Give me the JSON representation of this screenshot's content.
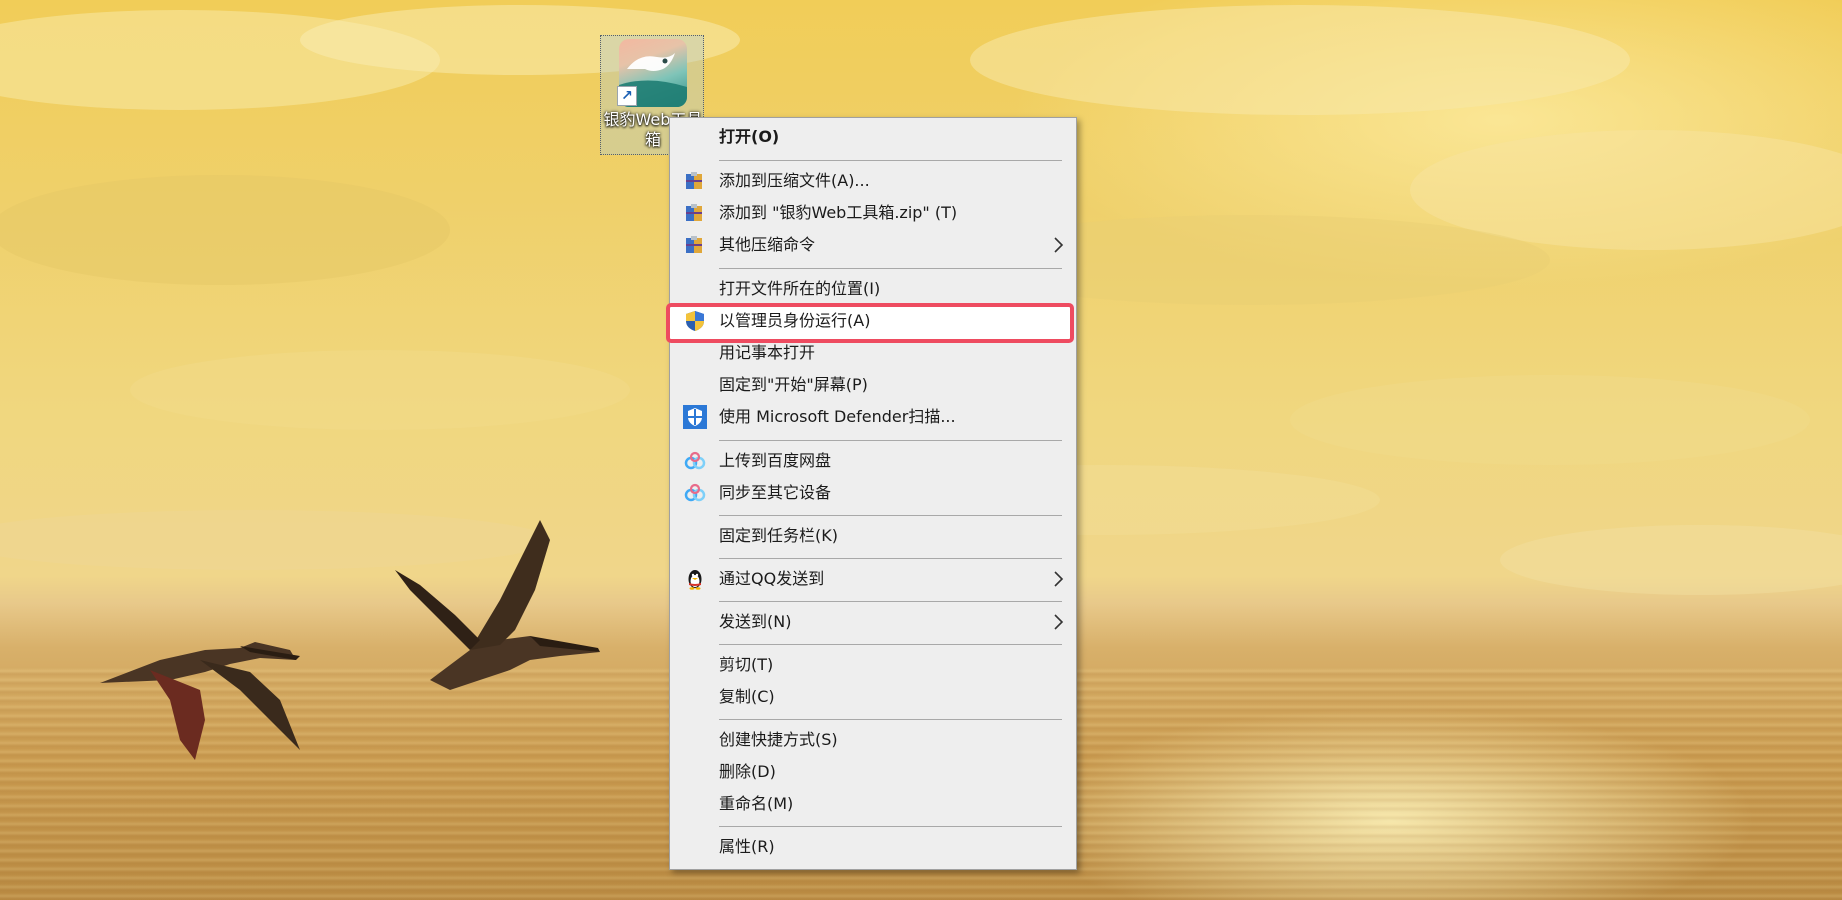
{
  "desktop": {
    "shortcut": {
      "label": "银豹Web工具箱",
      "icon": "app-shortcut-icon"
    }
  },
  "context_menu": {
    "items": [
      {
        "label": "打开(O)",
        "bold": true,
        "icon": null
      },
      {
        "label": "添加到压缩文件(A)...",
        "icon": "archive-icon"
      },
      {
        "label": "添加到 \"银豹Web工具箱.zip\" (T)",
        "icon": "archive-icon"
      },
      {
        "label": "其他压缩命令",
        "icon": "archive-icon",
        "submenu": true
      },
      {
        "label": "打开文件所在的位置(I)",
        "icon": null
      },
      {
        "label": "以管理员身份运行(A)",
        "icon": "uac-shield-icon",
        "highlighted": true
      },
      {
        "label": "用记事本打开",
        "icon": null
      },
      {
        "label": "固定到\"开始\"屏幕(P)",
        "icon": null
      },
      {
        "label": "使用 Microsoft Defender扫描...",
        "icon": "defender-shield-icon"
      },
      {
        "label": "上传到百度网盘",
        "icon": "baidu-netdisk-icon"
      },
      {
        "label": "同步至其它设备",
        "icon": "baidu-netdisk-icon"
      },
      {
        "label": "固定到任务栏(K)",
        "icon": null
      },
      {
        "label": "通过QQ发送到",
        "icon": "qq-penguin-icon",
        "submenu": true
      },
      {
        "label": "发送到(N)",
        "icon": null,
        "submenu": true
      },
      {
        "label": "剪切(T)",
        "icon": null
      },
      {
        "label": "复制(C)",
        "icon": null
      },
      {
        "label": "创建快捷方式(S)",
        "icon": null
      },
      {
        "label": "删除(D)",
        "icon": null
      },
      {
        "label": "重命名(M)",
        "icon": null
      },
      {
        "label": "属性(R)",
        "icon": null
      }
    ]
  },
  "colors": {
    "highlight_border": "#ee4b60",
    "menu_background": "#eeeeee"
  }
}
